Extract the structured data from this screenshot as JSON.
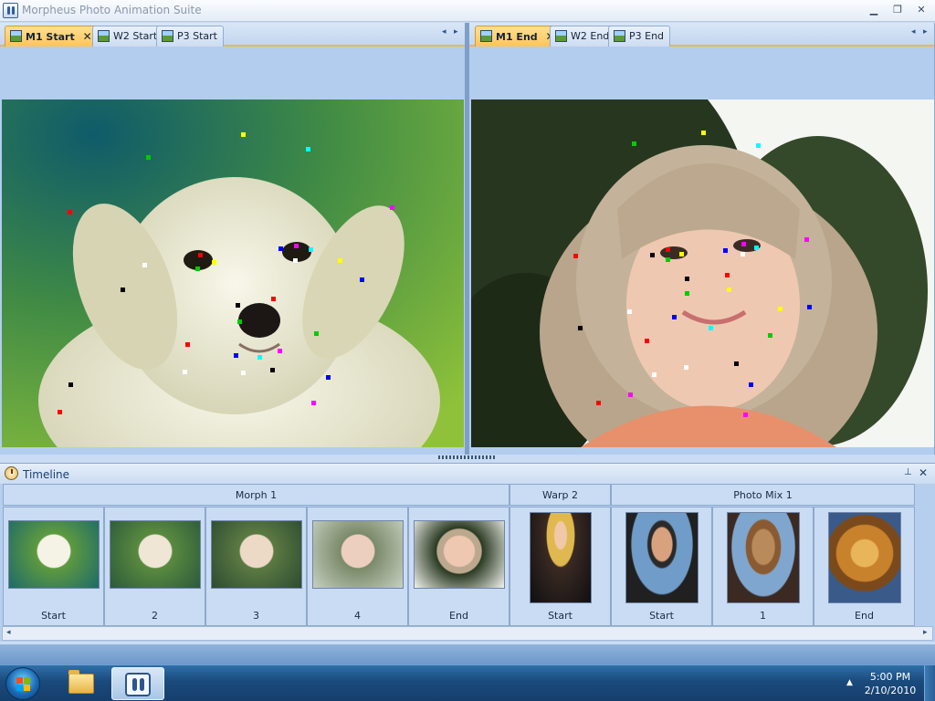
{
  "window": {
    "title": "Morpheus Photo Animation Suite",
    "controls": {
      "minimize": "▁",
      "restore": "❐",
      "close": "✕"
    }
  },
  "left_panel": {
    "tabs": [
      {
        "label": "M1 Start",
        "active": true,
        "closable": true
      },
      {
        "label": "W2 Start",
        "active": false
      },
      {
        "label": "P3 Start",
        "active": false
      }
    ],
    "scroll_prev": "◂",
    "scroll_next": "▸",
    "image": "puppy-photo"
  },
  "right_panel": {
    "tabs": [
      {
        "label": "M1 End",
        "active": true,
        "closable": true
      },
      {
        "label": "W2 End",
        "active": false
      },
      {
        "label": "P3 End",
        "active": false
      }
    ],
    "scroll_prev": "◂",
    "scroll_next": "▸",
    "image": "girl-photo"
  },
  "tab_close_glyph": "✕",
  "timeline": {
    "title": "Timeline",
    "pin_glyph": "⊥",
    "close_glyph": "✕",
    "groups": [
      {
        "name": "Morph 1",
        "frames": [
          "Start",
          "2",
          "3",
          "4",
          "End"
        ]
      },
      {
        "name": "Warp 2",
        "frames": [
          "Start"
        ]
      },
      {
        "name": "Photo Mix 1",
        "frames": [
          "Start",
          "1",
          "End"
        ]
      }
    ],
    "scroll_left": "◂",
    "scroll_right": "▸"
  },
  "taskbar": {
    "tray_arrow": "▲",
    "time": "5:00 PM",
    "date": "2/10/2010"
  },
  "colors": {
    "active_tab": "#ffc45a",
    "panel_bg": "#b3cdef",
    "taskbar": "#1a4a7c"
  },
  "icons": [
    "app-icon",
    "picture-icon",
    "timer-icon",
    "pin-icon",
    "close-icon",
    "windows-orb-icon",
    "folder-icon",
    "morpheus-icon"
  ]
}
